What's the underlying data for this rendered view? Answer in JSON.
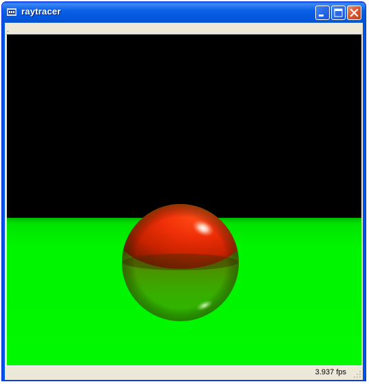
{
  "window": {
    "title": "raytracer",
    "app_icon": "window-icon",
    "buttons": {
      "minimize": "minimize-icon",
      "maximize": "maximize-icon",
      "close": "close-icon"
    }
  },
  "scene": {
    "sky_color": "#000000",
    "floor_color": "#00ff00",
    "sphere_color": "#ff2a00"
  },
  "status": {
    "fps": "3.937 fps"
  },
  "colors": {
    "titlebar": "#0054e3",
    "chrome": "#ece9d8",
    "close_button": "#db5a37"
  }
}
